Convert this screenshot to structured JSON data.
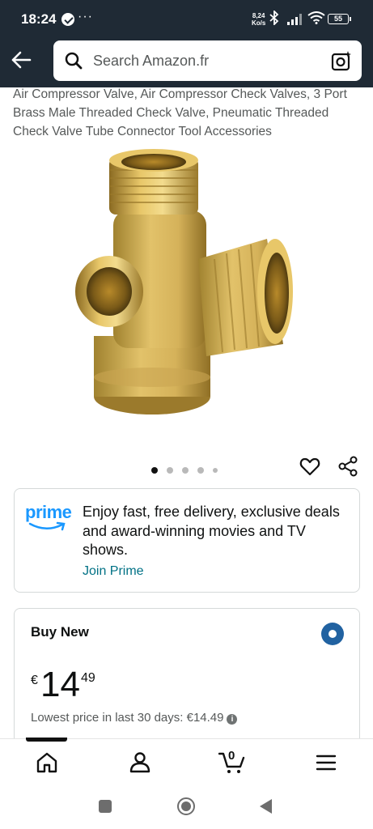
{
  "status_bar": {
    "time": "18:24",
    "more": "···",
    "net_speed_value": "8,24",
    "net_speed_unit": "Ko/s",
    "battery": "55"
  },
  "search": {
    "placeholder": "Search Amazon.fr"
  },
  "product": {
    "title": "Air Compressor Valve, Air Compressor Check Valves, 3 Port Brass Male Threaded Check Valve, Pneumatic Threaded Check Valve Tube Connector Tool Accessories",
    "image_count": 5,
    "active_image_index": 0
  },
  "prime": {
    "logo": "prime",
    "text": "Enjoy fast, free delivery, exclusive deals and award-winning movies and TV shows.",
    "link": "Join Prime"
  },
  "buy_new": {
    "title": "Buy New",
    "currency": "€",
    "price_whole": "14",
    "price_fraction": "49",
    "lowest_price_text": "Lowest price in last 30 days: €14.49"
  },
  "bottom_nav": {
    "items": [
      "home-icon",
      "account-icon",
      "cart-icon",
      "menu-icon"
    ],
    "cart_count": "0"
  },
  "colors": {
    "header_bg": "#1f2a35",
    "prime_blue": "#1a98ff",
    "link": "#007185",
    "radio": "#2162a1"
  }
}
